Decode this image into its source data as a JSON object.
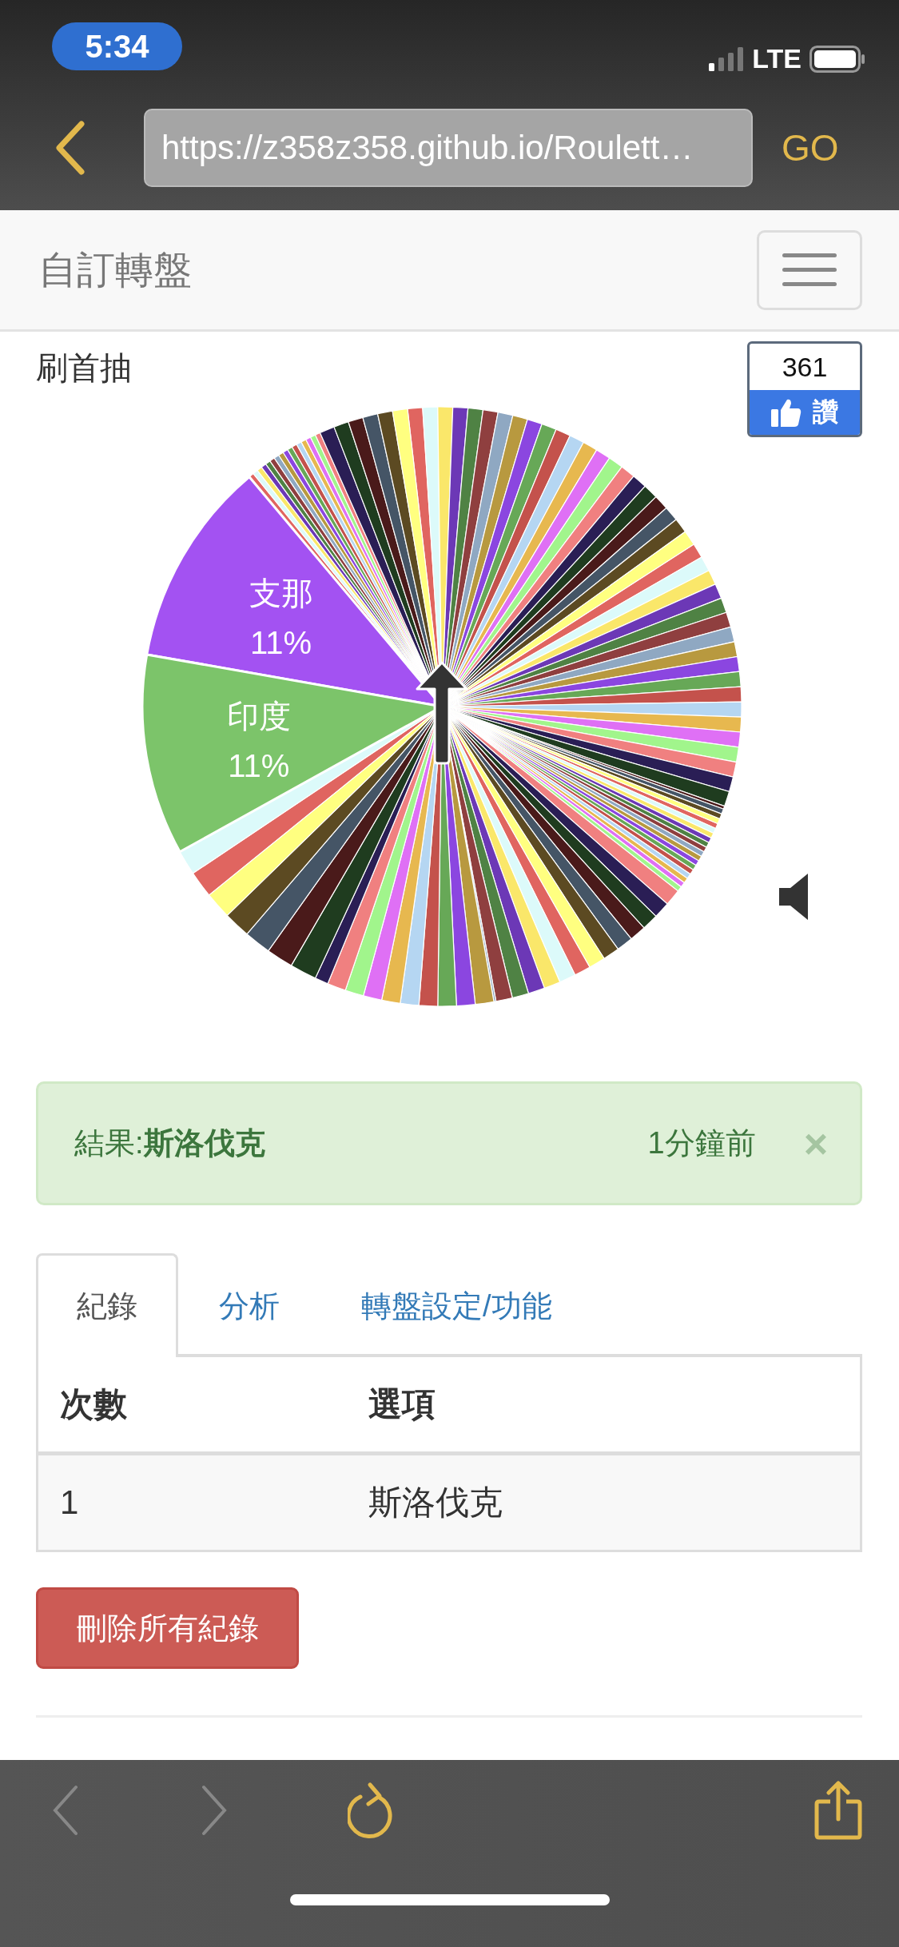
{
  "status_bar": {
    "time": "5:34",
    "network": "LTE"
  },
  "browser": {
    "url": "https://z358z358.github.io/Roulett…",
    "go": "GO"
  },
  "navbar": {
    "brand": "自訂轉盤"
  },
  "wheel": {
    "title": "刷首抽",
    "like_count": "361",
    "like_label": "讚",
    "slices": [
      {
        "label": "支那",
        "percent": "11%",
        "color": "#a352f2"
      },
      {
        "label": "印度",
        "percent": "11%",
        "color": "#7cc46a"
      }
    ]
  },
  "result": {
    "text": "結果:**斯洛伐克**",
    "time": "1分鐘前",
    "close": "×"
  },
  "tabs": [
    {
      "label": "紀錄",
      "selected": true
    },
    {
      "label": "分析",
      "selected": false
    },
    {
      "label": "轉盤設定/功能",
      "selected": false
    }
  ],
  "table": {
    "columns": [
      "次數",
      "選項"
    ],
    "rows": [
      [
        "1",
        "斯洛伐克"
      ]
    ]
  },
  "delete_button": "刪除所有紀錄"
}
